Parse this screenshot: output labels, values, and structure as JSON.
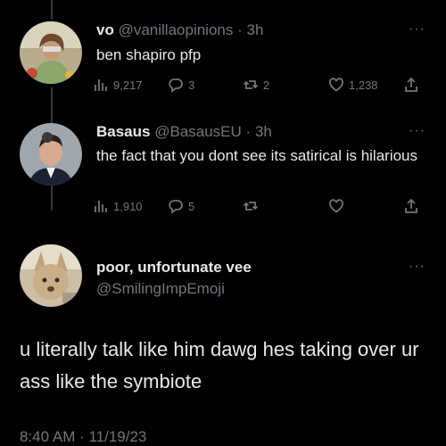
{
  "tweets": [
    {
      "name": "vo",
      "handle": "@vanillaopinions",
      "time": "3h",
      "text": "ben shapiro pfp",
      "views": "9,217",
      "replies": "3",
      "retweets": "2",
      "likes": "1,238",
      "more": "···"
    },
    {
      "name": "Basaus",
      "handle": "@BasausEU",
      "time": "3h",
      "text": "the fact that you dont see its satirical is hilarious",
      "views": "1,910",
      "replies": "5",
      "more": "···"
    }
  ],
  "main_tweet": {
    "name": "poor, unfortunate vee",
    "handle": "@SmilingImpEmoji",
    "text": "u literally talk like him dawg hes taking over ur ass like the symbiote",
    "timestamp": "8:40 AM · 11/19/23",
    "more": "···"
  },
  "separator": "·"
}
